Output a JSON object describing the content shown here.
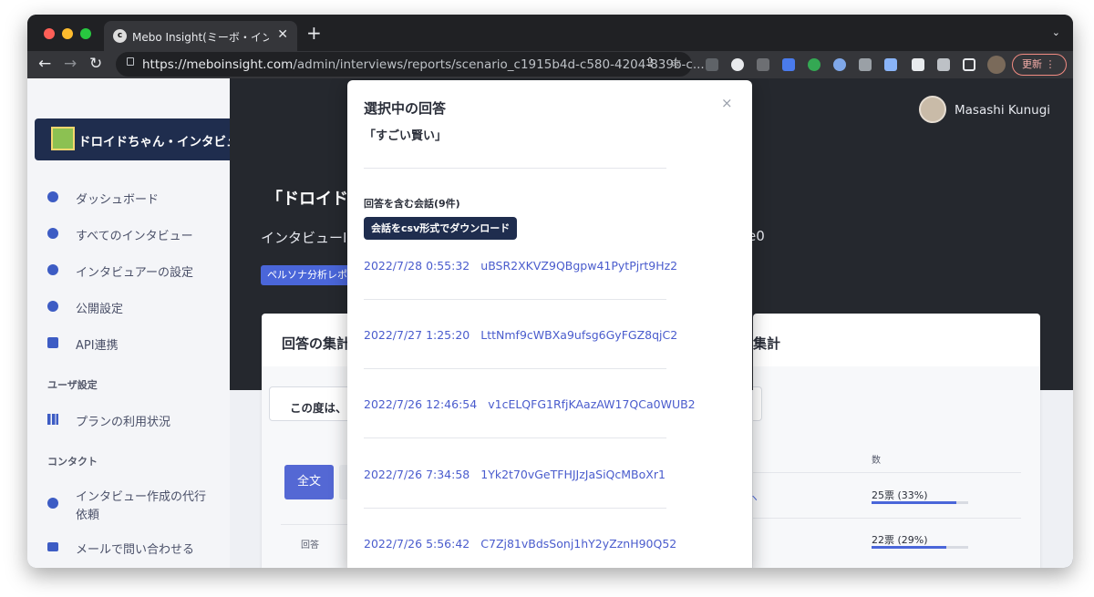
{
  "browser": {
    "tab_title": "Mebo Insight(ミーボ・インサイト",
    "tab_favicon": "c",
    "url_domain": "https://meboinsight.com",
    "url_path": "/admin/interviews/reports/scenario_c1915b4d-c580-4204-839b-c...",
    "update_label": "更新"
  },
  "sidebar": {
    "brand": "ドロイドちゃん・インタビュ",
    "items": [
      {
        "label": "ダッシュボード",
        "icon": "pie-chart-icon"
      },
      {
        "label": "すべてのインタビュー",
        "icon": "chat-icon"
      },
      {
        "label": "インタビュアーの設定",
        "icon": "smile-icon"
      },
      {
        "label": "公開設定",
        "icon": "globe-icon"
      },
      {
        "label": "API連携",
        "icon": "cube-icon"
      }
    ],
    "section_user": "ユーザ設定",
    "plan_label": "プランの利用状況",
    "section_contact": "コンタクト",
    "request_label_1": "インタビュー作成の代行",
    "request_label_2": "依頼",
    "mail_label": "メールで問い合わせる"
  },
  "header": {
    "user_name": "Masashi Kunugi",
    "title": "「ドロイド",
    "sub": "インタビューID",
    "sub_end": "e0",
    "badge": "ペルソナ分析レポート"
  },
  "main": {
    "card_left_title": "回答の集計",
    "card_right_title": "集計",
    "question": "この度は、",
    "btn_all": "全文",
    "col_answer": "回答",
    "col_count": "数",
    "votes": [
      {
        "label": "25票 (33%)",
        "fraction": 0.33
      },
      {
        "label": "22票 (29%)",
        "fraction": 0.29
      }
    ]
  },
  "modal": {
    "title": "選択中の回答",
    "answer": "「すごい賢い」",
    "section": "回答を含む会話(9件)",
    "download_label": "会話をcsv形式でダウンロード",
    "close": "×",
    "conversations": [
      {
        "date": "2022/7/28 0:55:32",
        "id": "uBSR2XKVZ9QBgpw41PytPjrt9Hz2"
      },
      {
        "date": "2022/7/27 1:25:20",
        "id": "LttNmf9cWBXa9ufsg6GyFGZ8qjC2"
      },
      {
        "date": "2022/7/26 12:46:54",
        "id": "v1cELQFG1RfjKAazAW17QCa0WUB2"
      },
      {
        "date": "2022/7/26 7:34:58",
        "id": "1Yk2t70vGeTFHJJzJaSiQcMBoXr1"
      },
      {
        "date": "2022/7/26 5:56:42",
        "id": "C7Zj81vBdsSonj1hY2yZznH90Q52"
      }
    ]
  }
}
